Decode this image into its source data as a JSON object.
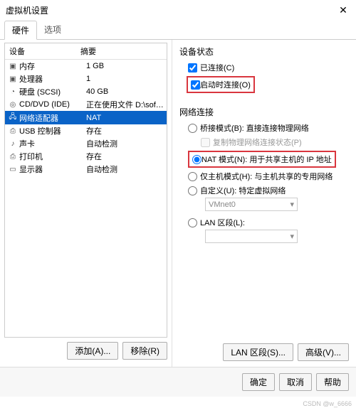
{
  "title": "虚拟机设置",
  "tabs": {
    "hardware": "硬件",
    "options": "选项"
  },
  "columns": {
    "device": "设备",
    "summary": "摘要"
  },
  "devices": [
    {
      "name": "内存",
      "summary": "1 GB",
      "icon": "▣"
    },
    {
      "name": "处理器",
      "summary": "1",
      "icon": "▣"
    },
    {
      "name": "硬盘 (SCSI)",
      "summary": "40 GB",
      "icon": "◔"
    },
    {
      "name": "CD/DVD (IDE)",
      "summary": "正在使用文件 D:\\software\\VM...",
      "icon": "◎"
    },
    {
      "name": "网络适配器",
      "summary": "NAT",
      "icon": "🖧"
    },
    {
      "name": "USB 控制器",
      "summary": "存在",
      "icon": "⎙"
    },
    {
      "name": "声卡",
      "summary": "自动检测",
      "icon": "♪"
    },
    {
      "name": "打印机",
      "summary": "存在",
      "icon": "⎙"
    },
    {
      "name": "显示器",
      "summary": "自动检测",
      "icon": "▭"
    }
  ],
  "left_buttons": {
    "add": "添加(A)...",
    "remove": "移除(R)"
  },
  "status": {
    "title": "设备状态",
    "connected": "已连接(C)",
    "connect_on": "启动时连接(O)"
  },
  "net": {
    "title": "网络连接",
    "bridged": "桥接模式(B): 直接连接物理网络",
    "replicate": "复制物理网络连接状态(P)",
    "nat": "NAT 模式(N): 用于共享主机的 IP 地址",
    "hostonly": "仅主机模式(H): 与主机共享的专用网络",
    "custom": "自定义(U): 特定虚拟网络",
    "vmnet": "VMnet0",
    "lan": "LAN 区段(L):"
  },
  "right_buttons": {
    "lan": "LAN 区段(S)...",
    "adv": "高级(V)..."
  },
  "footer": {
    "ok": "确定",
    "cancel": "取消",
    "help": "帮助"
  },
  "watermark": "CSDN @w_6666"
}
